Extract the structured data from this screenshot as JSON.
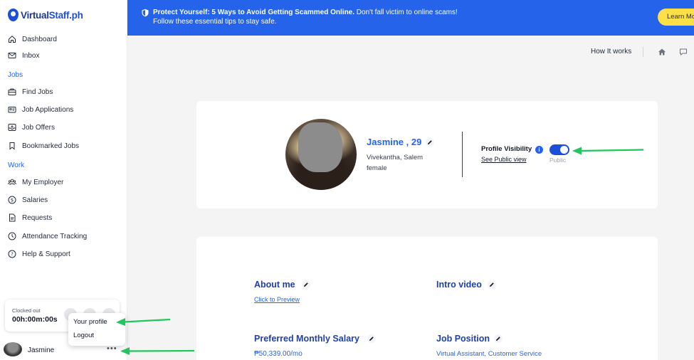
{
  "brand": {
    "name_part1": "Virtual",
    "name_part2": "Staff.ph"
  },
  "sidebar": {
    "items": [
      {
        "label": "Dashboard",
        "icon": "home-icon"
      },
      {
        "label": "Inbox",
        "icon": "mail-icon"
      }
    ],
    "sections": [
      {
        "title": "Jobs",
        "items": [
          {
            "label": "Find Jobs",
            "icon": "briefcase-icon"
          },
          {
            "label": "Job Applications",
            "icon": "id-card-icon"
          },
          {
            "label": "Job Offers",
            "icon": "inbox-icon"
          },
          {
            "label": "Bookmarked Jobs",
            "icon": "bookmark-icon"
          }
        ]
      },
      {
        "title": "Work",
        "items": [
          {
            "label": "My Employer",
            "icon": "users-icon"
          },
          {
            "label": "Salaries",
            "icon": "dollar-icon"
          },
          {
            "label": "Requests",
            "icon": "document-icon"
          },
          {
            "label": "Attendance Tracking",
            "icon": "clock-icon"
          },
          {
            "label": "Help & Support",
            "icon": "help-icon"
          }
        ]
      }
    ]
  },
  "clock": {
    "status": "Clocked out",
    "time": "00h:00m:00s"
  },
  "user_menu": {
    "items": [
      "Your profile",
      "Logout"
    ]
  },
  "user": {
    "name": "Jasmine",
    "more": "•••"
  },
  "banner": {
    "headline": "Protect Yourself: 5 Ways to Avoid Getting Scammed Online.",
    "text": " Don't fall victim to online scams!",
    "line2": "Follow these essential tips to stay safe.",
    "button": "Learn Mo"
  },
  "topnav": {
    "how_it_works": "How It works"
  },
  "profile": {
    "name": "Jasmine , 29",
    "location": "Vivekantha, Salem",
    "gender": "female",
    "visibility_label": "Profile Visibility",
    "public_link": "See Public view",
    "visibility_status": "Public",
    "visibility_on": true
  },
  "details": {
    "about_title": "About me",
    "about_link": "Click to Preview",
    "intro_title": "Intro video",
    "salary_title": "Preferred Monthly Salary",
    "salary_value": "₱50,339.00/mo",
    "position_title": "Job Position",
    "position_value": "Virtual Assistant, Customer Service"
  },
  "colors": {
    "primary": "#2563eb",
    "banner": "#2563eb",
    "button": "#fde047",
    "arrow": "#22c55e"
  }
}
